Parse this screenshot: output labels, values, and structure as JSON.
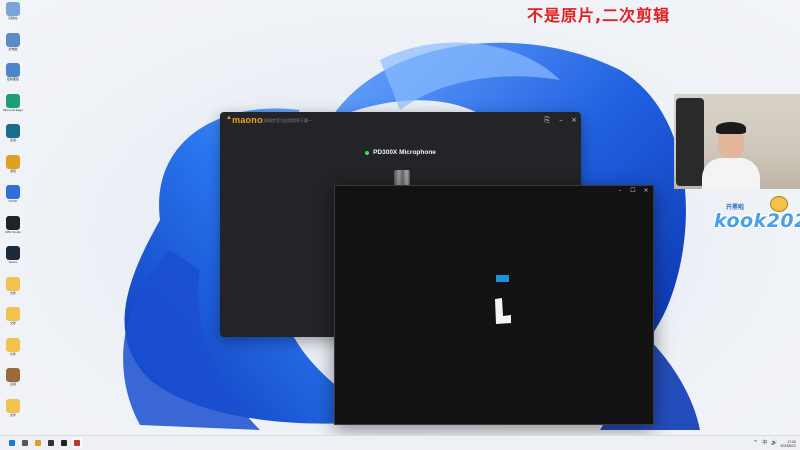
{
  "caption": "不是原片,二次剪辑",
  "desktop": {
    "icons": [
      {
        "name": "recycle-bin",
        "label": "回收站",
        "color": "#7aa3d8"
      },
      {
        "name": "app-2",
        "label": "此电脑",
        "color": "#5a8cc8"
      },
      {
        "name": "app-3",
        "label": "控制面板",
        "color": "#4b86c9"
      },
      {
        "name": "edge",
        "label": "Microsoft Edge",
        "color": "#1f9d74"
      },
      {
        "name": "app-5",
        "label": "应用",
        "color": "#1a6b8e"
      },
      {
        "name": "app-6",
        "label": "游戏",
        "color": "#e0a020"
      },
      {
        "name": "kook",
        "label": "KOOK",
        "color": "#2f6fd6"
      },
      {
        "name": "obs",
        "label": "OBS Studio",
        "color": "#222222"
      },
      {
        "name": "steam",
        "label": "Steam",
        "color": "#1b2838"
      },
      {
        "name": "folder-1",
        "label": "文件",
        "color": "#f2c14e"
      },
      {
        "name": "folder-2",
        "label": "文件",
        "color": "#f2c14e"
      },
      {
        "name": "folder-3",
        "label": "文件",
        "color": "#f2c14e"
      },
      {
        "name": "app-13",
        "label": "应用",
        "color": "#9a6a3a"
      },
      {
        "name": "folder-4",
        "label": "文件",
        "color": "#f2c14e"
      }
    ]
  },
  "maono": {
    "logo": "maono",
    "subtitle": "立即同步官方应用程序下载一",
    "minimize": "⎘",
    "maximize": "–",
    "close": "×",
    "device_name": "PD300X Microphone",
    "status_color": "#2ee05a"
  },
  "black_window": {
    "minimize": "–",
    "maximize": "☐",
    "close": "×"
  },
  "kook": {
    "text": "kook",
    "number": "202",
    "subtitle": "开黑啦"
  },
  "taskbar": {
    "apps": [
      {
        "name": "start",
        "color": "#1e78d8"
      },
      {
        "name": "search",
        "color": "#555555"
      },
      {
        "name": "app-a",
        "color": "#d8a020"
      },
      {
        "name": "app-b",
        "color": "#333333"
      },
      {
        "name": "app-c",
        "color": "#222222"
      },
      {
        "name": "app-d",
        "color": "#c83030"
      }
    ],
    "tray": {
      "up_arrow": "^",
      "lang": "中",
      "volume": "🔊"
    },
    "time": "17:00",
    "date": "2023/5/21"
  }
}
